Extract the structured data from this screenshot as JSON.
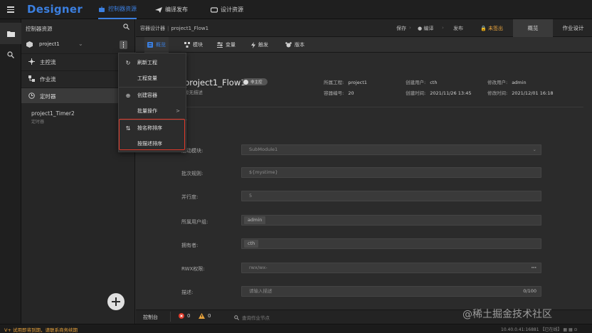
{
  "app": {
    "logo": "Designer",
    "nav": [
      {
        "label": "控制器资源",
        "icon": "robot-icon",
        "active": true
      },
      {
        "label": "编译发布",
        "icon": "send-icon",
        "active": false
      },
      {
        "label": "设计资源",
        "icon": "cloud-icon",
        "active": false
      }
    ],
    "accent": "#3b7fe0"
  },
  "sidebar": {
    "title": "控制器资源",
    "project": "project1",
    "tree": [
      {
        "label": "主控流",
        "icon": "main-flow-icon"
      },
      {
        "label": "作业流",
        "icon": "job-flow-icon"
      },
      {
        "label": "定时器",
        "icon": "clock-icon"
      }
    ],
    "timer": {
      "name": "project1_Timer2",
      "sub": "定时器"
    }
  },
  "context_menu": {
    "items": [
      {
        "label": "刷新工程",
        "icon": "refresh-icon"
      },
      {
        "label": "工程变量",
        "icon": ""
      },
      {
        "label": "创建容器",
        "icon": "plus-circle-icon"
      },
      {
        "label": "批量操作",
        "icon": "",
        "submenu": ">"
      },
      {
        "label": "按名称排序",
        "icon": "sort-icon"
      },
      {
        "label": "按描述排序",
        "icon": ""
      }
    ]
  },
  "header": {
    "breadcrumb": [
      "容器设计器",
      "project1_Flow1"
    ],
    "actions": {
      "save": "保存",
      "compile": "● 编译",
      "publish": "发布",
      "status": "🔒 未签出"
    },
    "tabs": [
      {
        "label": "概览",
        "active": true
      },
      {
        "label": "作业设计",
        "active": false
      }
    ]
  },
  "subtabs": [
    {
      "label": "概览",
      "icon": "overview-icon",
      "active": true
    },
    {
      "label": "模块",
      "icon": "module-icon",
      "active": false
    },
    {
      "label": "变量",
      "icon": "variable-icon",
      "active": false
    },
    {
      "label": "触发",
      "icon": "lightning-icon",
      "active": false
    },
    {
      "label": "版本",
      "icon": "version-icon",
      "active": false
    }
  ],
  "overview": {
    "title": "project1_Flow1",
    "toggle": "非主控",
    "desc": "暂无描述",
    "meta": [
      {
        "label": "所属工程:",
        "value": "project1"
      },
      {
        "label": "创建用户:",
        "value": "cth"
      },
      {
        "label": "修改用户:",
        "value": "admin"
      },
      {
        "label": "容器编号:",
        "value": "20"
      },
      {
        "label": "创建时间:",
        "value": "2021/11/26 13:45"
      },
      {
        "label": "修改时间:",
        "value": "2021/12/01 16:18"
      }
    ]
  },
  "form": [
    {
      "label": "启动模块:",
      "value": "SubModule1",
      "type": "select"
    },
    {
      "label": "批次规则:",
      "value": "${mystime}",
      "type": "text"
    },
    {
      "label": "并行度:",
      "value": "5",
      "type": "text"
    },
    {
      "label": "所属用户组:",
      "value": "admin",
      "type": "chip"
    },
    {
      "label": "拥有者:",
      "value": "cth",
      "type": "chip"
    },
    {
      "label": "RWX权限:",
      "value": "rwx/wx-",
      "type": "more"
    },
    {
      "label": "描述:",
      "value": "请输入描述",
      "counter": "0/100",
      "type": "textarea"
    }
  ],
  "statusbar": {
    "label": "控制台",
    "errors": "0",
    "warnings": "0",
    "search_placeholder": "查询作业节点"
  },
  "footer": {
    "warning": "V+ 试用即将到期，请联系商务续期",
    "right": "10.40.0.41:16881 【已在线】 ▦ ▦ ⊙"
  },
  "watermark": "@稀土掘金技术社区"
}
